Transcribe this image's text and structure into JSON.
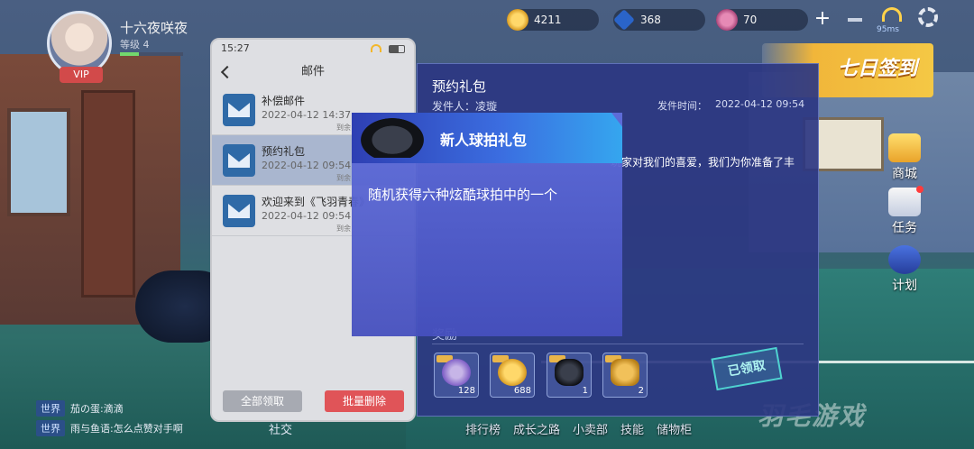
{
  "player": {
    "name": "十六夜咲夜",
    "level": "等级 4",
    "vip": "VIP",
    "exp_fraction": 0.3
  },
  "resources": {
    "coins": "4211",
    "gems": "368",
    "tickets": "70"
  },
  "hud": {
    "ping": "95ms",
    "seven_day": "七日签到"
  },
  "side_menu": {
    "shop": "商城",
    "task": "任务",
    "plan": "计划"
  },
  "bottom_nav": [
    "排行榜",
    "成长之路",
    "小卖部",
    "技能",
    "储物柜"
  ],
  "bottom_social": "社交",
  "brand": "羽毛游戏",
  "chat": [
    {
      "channel": "世界",
      "text": "茄の蛋:滴滴"
    },
    {
      "channel": "世界",
      "text": "雨与鱼语:怎么点赞对手啊"
    }
  ],
  "phone": {
    "time": "15:27",
    "title": "邮件",
    "mails": [
      {
        "title": "补偿邮件",
        "date": "2022-04-12 14:37",
        "remain": "到余"
      },
      {
        "title": "预约礼包",
        "date": "2022-04-12 09:54",
        "remain": "到余"
      },
      {
        "title": "欢迎来到《飞羽青春》",
        "date": "2022-04-12 09:54",
        "remain": "到余"
      }
    ],
    "claim_all": "全部领取",
    "batch_delete": "批量删除"
  },
  "detail": {
    "title": "预约礼包",
    "sender": "发件人：凌璇",
    "time_label": "发件时间：",
    "time": "2022-04-12 09:54",
    "body": "玩家对我们的喜爱，我们为你准备了丰",
    "reward_label": "奖励",
    "rewards": [
      {
        "icon": "purple-badge-icon",
        "count": "128"
      },
      {
        "icon": "gold-coin-icon",
        "count": "688"
      },
      {
        "icon": "racket-bag-icon",
        "count": "1"
      },
      {
        "icon": "yellow-bag-icon",
        "count": "2"
      }
    ],
    "claimed": "已领取"
  },
  "popup": {
    "title": "新人球拍礼包",
    "description": "随机获得六种炫酷球拍中的一个"
  }
}
